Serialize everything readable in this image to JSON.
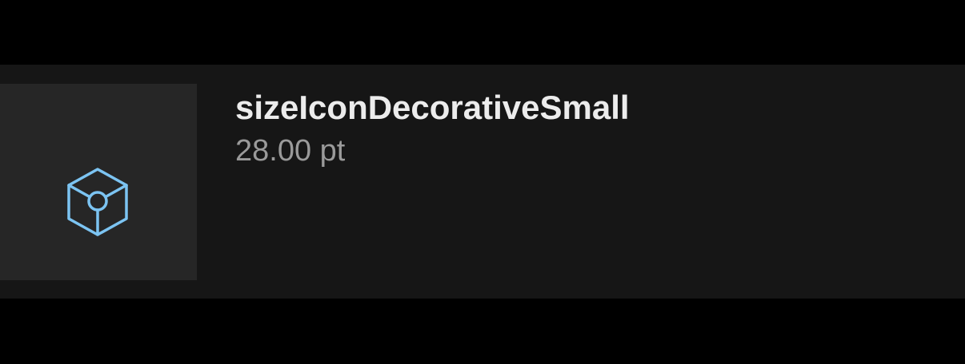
{
  "token": {
    "name": "sizeIconDecorativeSmall",
    "value": "28.00 pt",
    "icon": "cube-icon",
    "icon_color": "#7cc4f2"
  },
  "colors": {
    "page_background": "#000000",
    "row_background": "#161616",
    "tile_background": "#262626",
    "name_text": "#ececec",
    "value_text": "#9a9a9a"
  }
}
